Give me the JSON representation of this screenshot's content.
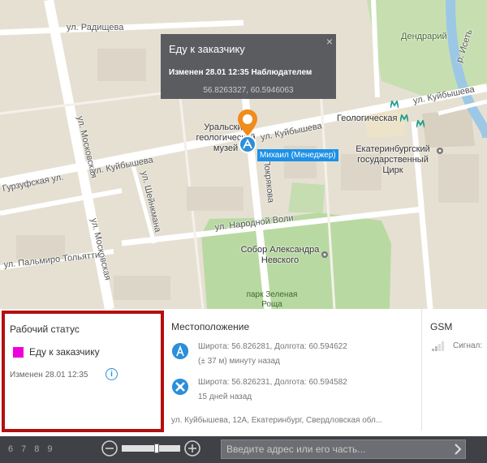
{
  "map": {
    "streets": {
      "radishcheva": "ул. Радищева",
      "moskovskaya_top": "ул. Московская",
      "moskovskaya_bottom": "ул. Московская",
      "kuybysheva_left": "ул. Куйбышева",
      "kuybysheva_mid": "ул. Куйбышева",
      "kuybysheva_right": "ул. Куйбышева",
      "gurzufskaya": "Гурзуфская ул.",
      "shcheynkmana": "ул. Шейнкмана",
      "narodnoy_voli": "ул. Народной Воли",
      "palmiro_tolyatti": "ул. Пальмиро Тольятти",
      "pokrovskaya": "Покрякова",
      "iset": "р. Исеть"
    },
    "pois": {
      "museum": "Уральский геологический музей",
      "sobor": "Собор Александра Невского",
      "park": "парк Зеленая Роща",
      "dendrary": "Дендрарий",
      "geological": "Геологическая",
      "circus": "Екатеринбургский государственный Цирк"
    },
    "popup": {
      "title": "Еду к заказчику",
      "close": "×",
      "changed": "Изменен 28.01 12:35 Наблюдателем",
      "coords": "56.8263327, 60.5946063"
    },
    "marker_label": "Михаил (Менеджер)"
  },
  "panel": {
    "status": {
      "heading": "Рабочий статус",
      "value": "Еду к заказчику",
      "color": "#ee00dd",
      "changed": "Изменен 28.01 12:35",
      "info_icon": "i"
    },
    "location": {
      "heading": "Местоположение",
      "rows": [
        {
          "line1": "Широта: 56.826281, Долгота: 60.594622",
          "line2": "(± 37 м)   минуту назад",
          "icon": "tower-icon"
        },
        {
          "line1": "Широта: 56.826231, Долгота: 60.594582",
          "line2": "15 дней назад",
          "icon": "satellite-icon"
        }
      ],
      "address": "ул. Куйбышева, 12А, Екатеринбург, Свердловская обл..."
    },
    "gsm": {
      "heading": "GSM",
      "signal": "Сигнал:"
    }
  },
  "bottombar": {
    "pages": [
      "6",
      "7",
      "8",
      "9"
    ],
    "zoom_level": 0.6,
    "search_placeholder": "Введите адрес или его часть..."
  }
}
